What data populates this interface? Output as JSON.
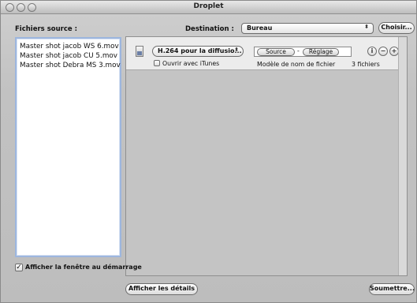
{
  "window": {
    "title": "Droplet"
  },
  "source": {
    "label": "Fichiers source :",
    "files": [
      "Master shot jacob WS 6.mov",
      "Master shot jacob CU 5.mov",
      "Master shot Debra MS 3.mov"
    ]
  },
  "destination": {
    "label": "Destination :",
    "value": "Bureau",
    "choose_label": "Choisir..."
  },
  "job": {
    "setting_value": "H.264 pour la diffusio...",
    "open_itunes_label": "Ouvrir avec iTunes",
    "open_itunes_checked": false,
    "tokens": [
      "Source",
      "-",
      "Réglage"
    ],
    "filename_template_label": "Modèle de nom de fichier",
    "file_count": "3 fichiers"
  },
  "footer": {
    "show_window_label": "Afficher la fenêtre au démarrage",
    "show_window_checked": true,
    "details_label": "Afficher les détails",
    "submit_label": "Soumettre..."
  },
  "colors": {
    "list_focus_border": "#9db6de",
    "window_bg": "#c2c2c2",
    "job_row_bg": "#ececec"
  }
}
